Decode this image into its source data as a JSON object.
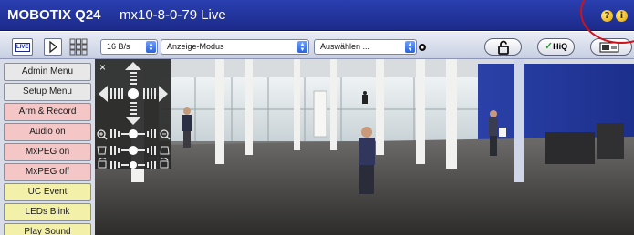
{
  "title": {
    "brand": "MOBOTIX Q24",
    "camera": "mx10-8-0-79 Live"
  },
  "header_icons": [
    "help-icon",
    "info-icon"
  ],
  "toolbar": {
    "live_label": "LIVE",
    "frame_rate": "16 B/s",
    "mode_select": "Anzeige-Modus",
    "action_select": "Auswählen ...",
    "hiq_label": "HiQ"
  },
  "sidebar": {
    "items": [
      {
        "label": "Admin Menu",
        "color": "#e6e6e6"
      },
      {
        "label": "Setup Menu",
        "color": "#e6e6e6"
      },
      {
        "label": "Arm & Record",
        "color": "#f3c4c4"
      },
      {
        "label": "Audio on",
        "color": "#f3c4c4"
      },
      {
        "label": "MxPEG on",
        "color": "#f3c4c4"
      },
      {
        "label": "MxPEG off",
        "color": "#f3c4c4"
      },
      {
        "label": "UC Event",
        "color": "#f2efa8"
      },
      {
        "label": "LEDs Blink",
        "color": "#f2efa8"
      },
      {
        "label": "Play Sound",
        "color": "#f2efa8"
      }
    ]
  },
  "ptz": {
    "close_label": "×"
  },
  "colors": {
    "title_bar": "#1c2a8a",
    "annotation": "#d1121a"
  }
}
